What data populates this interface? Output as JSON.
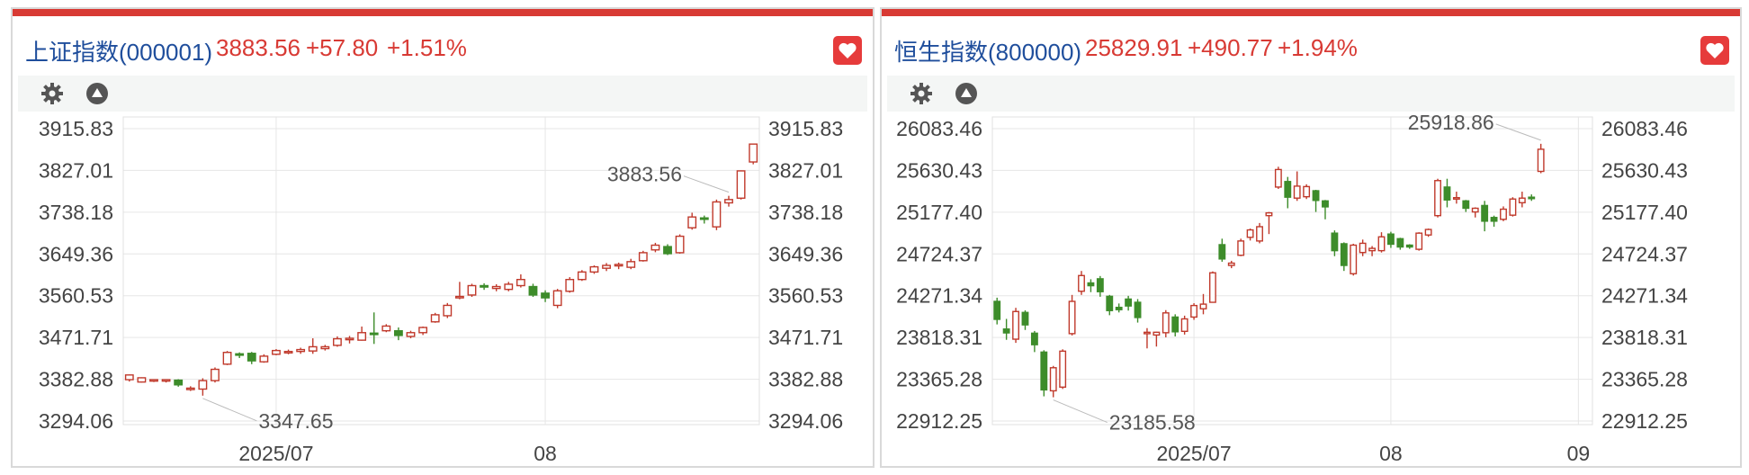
{
  "colors": {
    "up": "#c0392b",
    "down": "#3d8c2a",
    "accent": "#d83a34",
    "title": "#1f4e9c",
    "grid": "#e6e6e6"
  },
  "panels": [
    {
      "title": "上证指数(000001)",
      "price": "3883.56",
      "change": "+57.80",
      "change_pct": "+1.51%",
      "settings_icon": "gear-icon",
      "collapse_icon": "triangle-up-icon",
      "favorite_icon": "heart-icon",
      "high_label": "3883.56",
      "low_label": "3347.65"
    },
    {
      "title": "恒生指数(800000)",
      "price": "25829.91",
      "change": "+490.77",
      "change_pct": "+1.94%",
      "settings_icon": "gear-icon",
      "collapse_icon": "triangle-up-icon",
      "favorite_icon": "heart-icon",
      "high_label": "25918.86",
      "low_label": "23185.58"
    }
  ],
  "chart_data": [
    {
      "type": "candlestick",
      "title": "上证指数(000001)",
      "y_ticks": [
        3915.83,
        3827.01,
        3738.18,
        3649.36,
        3560.53,
        3471.71,
        3382.88,
        3294.06
      ],
      "ylim": [
        3294.06,
        3915.83
      ],
      "x_ticks": [
        "2025/07",
        "08"
      ],
      "x_tick_index": [
        12,
        34
      ],
      "n_slots": 52,
      "annotations": [
        {
          "label": "3883.56",
          "index": 49
        },
        {
          "label": "3347.65",
          "index": 6
        }
      ],
      "candles": [
        [
          0,
          3382,
          3392,
          3378,
          3393
        ],
        [
          1,
          3377,
          3386,
          3376,
          3387
        ],
        [
          2,
          3381,
          3382,
          3377,
          3383
        ],
        [
          3,
          3381,
          3382,
          3376,
          3383
        ],
        [
          4,
          3381,
          3371,
          3367,
          3383
        ],
        [
          5,
          3364,
          3364,
          3358,
          3368
        ],
        [
          6,
          3362,
          3380,
          3348,
          3385
        ],
        [
          7,
          3380,
          3404,
          3376,
          3408
        ],
        [
          8,
          3415,
          3440,
          3413,
          3443
        ],
        [
          9,
          3437,
          3435,
          3428,
          3440
        ],
        [
          10,
          3438,
          3422,
          3415,
          3441
        ],
        [
          11,
          3420,
          3432,
          3418,
          3436
        ],
        [
          12,
          3436,
          3444,
          3434,
          3447
        ],
        [
          13,
          3441,
          3442,
          3436,
          3446
        ],
        [
          14,
          3442,
          3446,
          3437,
          3450
        ],
        [
          15,
          3443,
          3452,
          3437,
          3470
        ],
        [
          16,
          3448,
          3452,
          3444,
          3456
        ],
        [
          17,
          3455,
          3469,
          3452,
          3474
        ],
        [
          18,
          3468,
          3470,
          3459,
          3475
        ],
        [
          19,
          3466,
          3482,
          3465,
          3495
        ],
        [
          20,
          3481,
          3480,
          3458,
          3525
        ],
        [
          21,
          3486,
          3496,
          3483,
          3500
        ],
        [
          22,
          3486,
          3476,
          3466,
          3493
        ],
        [
          23,
          3474,
          3482,
          3470,
          3486
        ],
        [
          24,
          3482,
          3493,
          3477,
          3495
        ],
        [
          25,
          3505,
          3520,
          3503,
          3524
        ],
        [
          26,
          3518,
          3540,
          3513,
          3545
        ],
        [
          27,
          3559,
          3559,
          3553,
          3590
        ],
        [
          28,
          3562,
          3582,
          3558,
          3586
        ],
        [
          29,
          3582,
          3580,
          3573,
          3587
        ],
        [
          30,
          3576,
          3580,
          3570,
          3585
        ],
        [
          31,
          3574,
          3585,
          3570,
          3590
        ],
        [
          32,
          3582,
          3595,
          3578,
          3606
        ],
        [
          33,
          3580,
          3562,
          3558,
          3586
        ],
        [
          34,
          3566,
          3556,
          3547,
          3572
        ],
        [
          35,
          3540,
          3571,
          3534,
          3575
        ],
        [
          36,
          3570,
          3595,
          3567,
          3600
        ],
        [
          37,
          3595,
          3611,
          3592,
          3615
        ],
        [
          38,
          3611,
          3622,
          3607,
          3625
        ],
        [
          39,
          3619,
          3625,
          3613,
          3630
        ],
        [
          40,
          3624,
          3627,
          3617,
          3631
        ],
        [
          41,
          3621,
          3633,
          3617,
          3639
        ],
        [
          42,
          3635,
          3652,
          3633,
          3656
        ],
        [
          43,
          3658,
          3668,
          3653,
          3673
        ],
        [
          44,
          3665,
          3650,
          3647,
          3670
        ],
        [
          45,
          3652,
          3687,
          3650,
          3691
        ],
        [
          46,
          3705,
          3728,
          3701,
          3737
        ],
        [
          47,
          3726,
          3725,
          3714,
          3731
        ],
        [
          48,
          3707,
          3760,
          3700,
          3765
        ],
        [
          49,
          3758,
          3765,
          3750,
          3773
        ],
        [
          50,
          3768,
          3826,
          3765,
          3827
        ],
        [
          51,
          3845,
          3883,
          3840,
          3884
        ]
      ]
    },
    {
      "type": "candlestick",
      "title": "恒生指数(800000)",
      "y_ticks": [
        26083.46,
        25630.43,
        25177.4,
        24724.37,
        24271.34,
        23818.31,
        23365.28,
        22912.25
      ],
      "ylim": [
        22912.25,
        26083.46
      ],
      "x_ticks": [
        "2025/07",
        "08",
        "09"
      ],
      "x_tick_index": [
        21,
        42,
        62
      ],
      "n_slots": 64,
      "annotations": [
        {
          "label": "25918.86",
          "index": 58
        },
        {
          "label": "23185.58",
          "index": 6
        }
      ],
      "candles": [
        [
          0,
          24210,
          24015,
          23960,
          24250
        ],
        [
          1,
          23910,
          23868,
          23793,
          24020
        ],
        [
          2,
          23800,
          24100,
          23760,
          24140
        ],
        [
          3,
          24090,
          23955,
          23900,
          24113
        ],
        [
          4,
          23865,
          23740,
          23660,
          23889
        ],
        [
          5,
          23660,
          23250,
          23180,
          23680
        ],
        [
          6,
          23240,
          23490,
          23170,
          23510
        ],
        [
          7,
          23280,
          23670,
          23260,
          23690
        ],
        [
          8,
          23860,
          24210,
          23840,
          24280
        ],
        [
          9,
          24320,
          24490,
          24280,
          24540
        ],
        [
          10,
          24410,
          24380,
          24310,
          24450
        ],
        [
          11,
          24455,
          24315,
          24260,
          24485
        ],
        [
          12,
          24265,
          24110,
          24060,
          24280
        ],
        [
          13,
          24145,
          24120,
          24090,
          24187
        ],
        [
          14,
          24235,
          24160,
          24110,
          24270
        ],
        [
          15,
          24200,
          24035,
          23980,
          24235
        ],
        [
          16,
          23875,
          23875,
          23700,
          23920
        ],
        [
          17,
          23845,
          23875,
          23720,
          23880
        ],
        [
          18,
          23870,
          24085,
          23820,
          24115
        ],
        [
          19,
          24040,
          23880,
          23830,
          24070
        ],
        [
          20,
          23885,
          24020,
          23850,
          24055
        ],
        [
          21,
          24040,
          24165,
          24010,
          24190
        ],
        [
          22,
          24130,
          24180,
          24070,
          24290
        ],
        [
          23,
          24200,
          24520,
          24195,
          24535
        ],
        [
          24,
          24825,
          24670,
          24640,
          24890
        ],
        [
          25,
          24600,
          24625,
          24570,
          24650
        ],
        [
          26,
          24710,
          24865,
          24700,
          24890
        ],
        [
          27,
          24905,
          24985,
          24870,
          25000
        ],
        [
          28,
          24865,
          25020,
          24840,
          25060
        ],
        [
          29,
          25140,
          25170,
          24940,
          25180
        ],
        [
          30,
          25450,
          25640,
          25430,
          25670
        ],
        [
          31,
          25510,
          25340,
          25220,
          25560
        ],
        [
          32,
          25330,
          25460,
          25300,
          25620
        ],
        [
          33,
          25345,
          25455,
          25320,
          25480
        ],
        [
          34,
          25410,
          25305,
          25180,
          25420
        ],
        [
          35,
          25300,
          25235,
          25100,
          25310
        ],
        [
          36,
          24950,
          24760,
          24700,
          24980
        ],
        [
          37,
          24835,
          24600,
          24540,
          24850
        ],
        [
          38,
          24510,
          24820,
          24490,
          24835
        ],
        [
          39,
          24740,
          24840,
          24700,
          24880
        ],
        [
          40,
          24760,
          24785,
          24700,
          24810
        ],
        [
          41,
          24760,
          24910,
          24740,
          24960
        ],
        [
          42,
          24940,
          24830,
          24790,
          24965
        ],
        [
          43,
          24890,
          24800,
          24770,
          24900
        ],
        [
          44,
          24820,
          24800,
          24780,
          24830
        ],
        [
          45,
          24775,
          24950,
          24760,
          24960
        ],
        [
          46,
          24930,
          24990,
          24910,
          25000
        ],
        [
          47,
          25140,
          25520,
          25120,
          25540
        ],
        [
          48,
          25450,
          25310,
          25230,
          25540
        ],
        [
          49,
          25335,
          25335,
          25270,
          25400
        ],
        [
          50,
          25300,
          25220,
          25180,
          25310
        ],
        [
          51,
          25180,
          25220,
          25120,
          25230
        ],
        [
          52,
          25250,
          25080,
          24970,
          25300
        ],
        [
          53,
          25120,
          25080,
          25020,
          25140
        ],
        [
          54,
          25100,
          25210,
          25080,
          25240
        ],
        [
          55,
          25145,
          25320,
          25130,
          25340
        ],
        [
          56,
          25280,
          25330,
          25230,
          25400
        ],
        [
          57,
          25340,
          25335,
          25300,
          25370
        ],
        [
          58,
          25620,
          25860,
          25600,
          25919
        ]
      ]
    }
  ]
}
